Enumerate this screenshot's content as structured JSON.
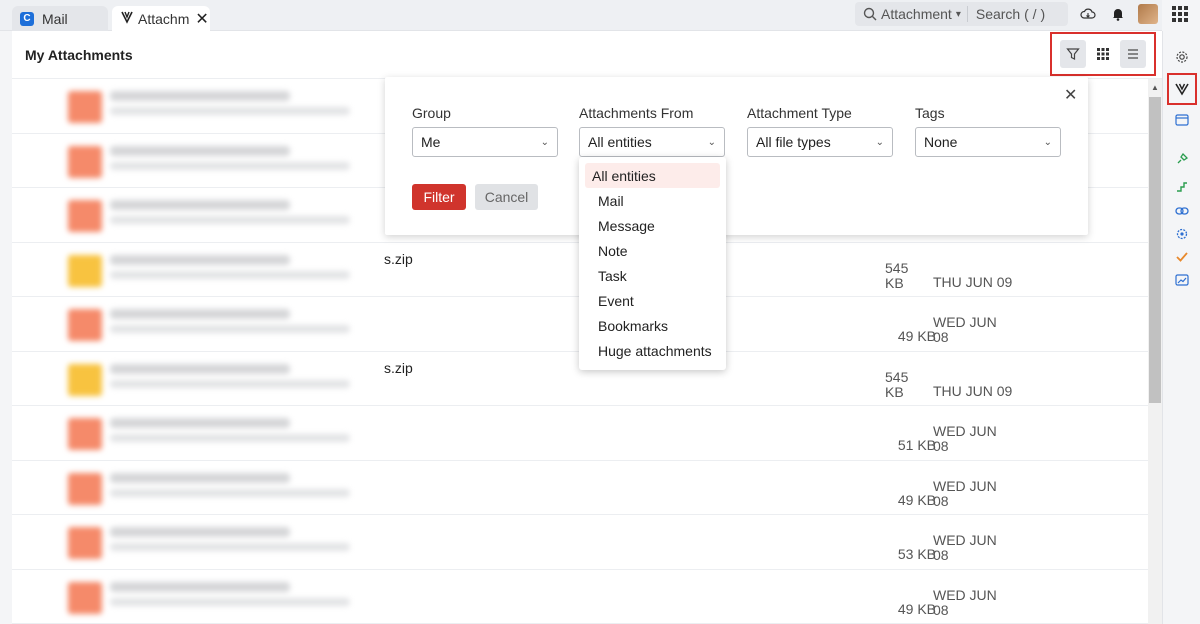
{
  "tabs": [
    {
      "label": "Mail"
    },
    {
      "label": "Attachm"
    }
  ],
  "search": {
    "scope": "Attachment",
    "placeholder": "Search ( / )"
  },
  "page": {
    "title": "My Attachments"
  },
  "filter": {
    "groups": [
      {
        "label": "Group",
        "value": "Me"
      },
      {
        "label": "Attachments From",
        "value": "All entities"
      },
      {
        "label": "Attachment Type",
        "value": "All file types"
      },
      {
        "label": "Tags",
        "value": "None"
      }
    ],
    "filter_label": "Filter",
    "cancel_label": "Cancel",
    "dropdown_options": [
      "All entities",
      "Mail",
      "Message",
      "Note",
      "Task",
      "Event",
      "Bookmarks",
      "Huge attachments"
    ],
    "selected_option": "All entities"
  },
  "rows": [
    {
      "type": "pdf",
      "name": "",
      "size1": "",
      "size2": "",
      "date1": "",
      "date2": ""
    },
    {
      "type": "pdf",
      "name": "",
      "size1": "",
      "size2": "",
      "date1": "",
      "date2": ""
    },
    {
      "type": "pdf",
      "name": "",
      "size1": "",
      "size2": "",
      "date1": "",
      "date2": ""
    },
    {
      "type": "zip",
      "name": "s.zip",
      "size1": "545",
      "size2": "KB",
      "date1": "THU JUN 09",
      "date2": ""
    },
    {
      "type": "pdf",
      "name": "",
      "size1": "",
      "size2": "49 KB",
      "date1": "WED JUN",
      "date2": "08"
    },
    {
      "type": "zip",
      "name": "s.zip",
      "size1": "545",
      "size2": "KB",
      "date1": "THU JUN 09",
      "date2": ""
    },
    {
      "type": "pdf",
      "name": "",
      "size1": "",
      "size2": "51 KB",
      "date1": "WED JUN",
      "date2": "08"
    },
    {
      "type": "pdf",
      "name": "",
      "size1": "",
      "size2": "49 KB",
      "date1": "WED JUN",
      "date2": "08"
    },
    {
      "type": "pdf",
      "name": "",
      "size1": "",
      "size2": "53 KB",
      "date1": "WED JUN",
      "date2": "08"
    },
    {
      "type": "pdf",
      "name": "",
      "size1": "",
      "size2": "49 KB",
      "date1": "WED JUN",
      "date2": "08"
    }
  ],
  "colors": {
    "accent": "#d0342c",
    "highlight_border": "#d9302c",
    "pdf_thumb": "#f58a6a",
    "zip_thumb": "#f8c340"
  },
  "icons": {
    "top": [
      "cloud-icon",
      "bell-icon",
      "avatar",
      "apps-grid-icon"
    ],
    "rail": [
      "gear-icon",
      "attachment-app-icon",
      "window-icon",
      "pin-icon",
      "steps-icon",
      "link-icon",
      "gear-group-icon",
      "check-icon",
      "chart-icon"
    ],
    "view": [
      "filter-icon",
      "grid-view-icon",
      "list-view-icon"
    ]
  }
}
